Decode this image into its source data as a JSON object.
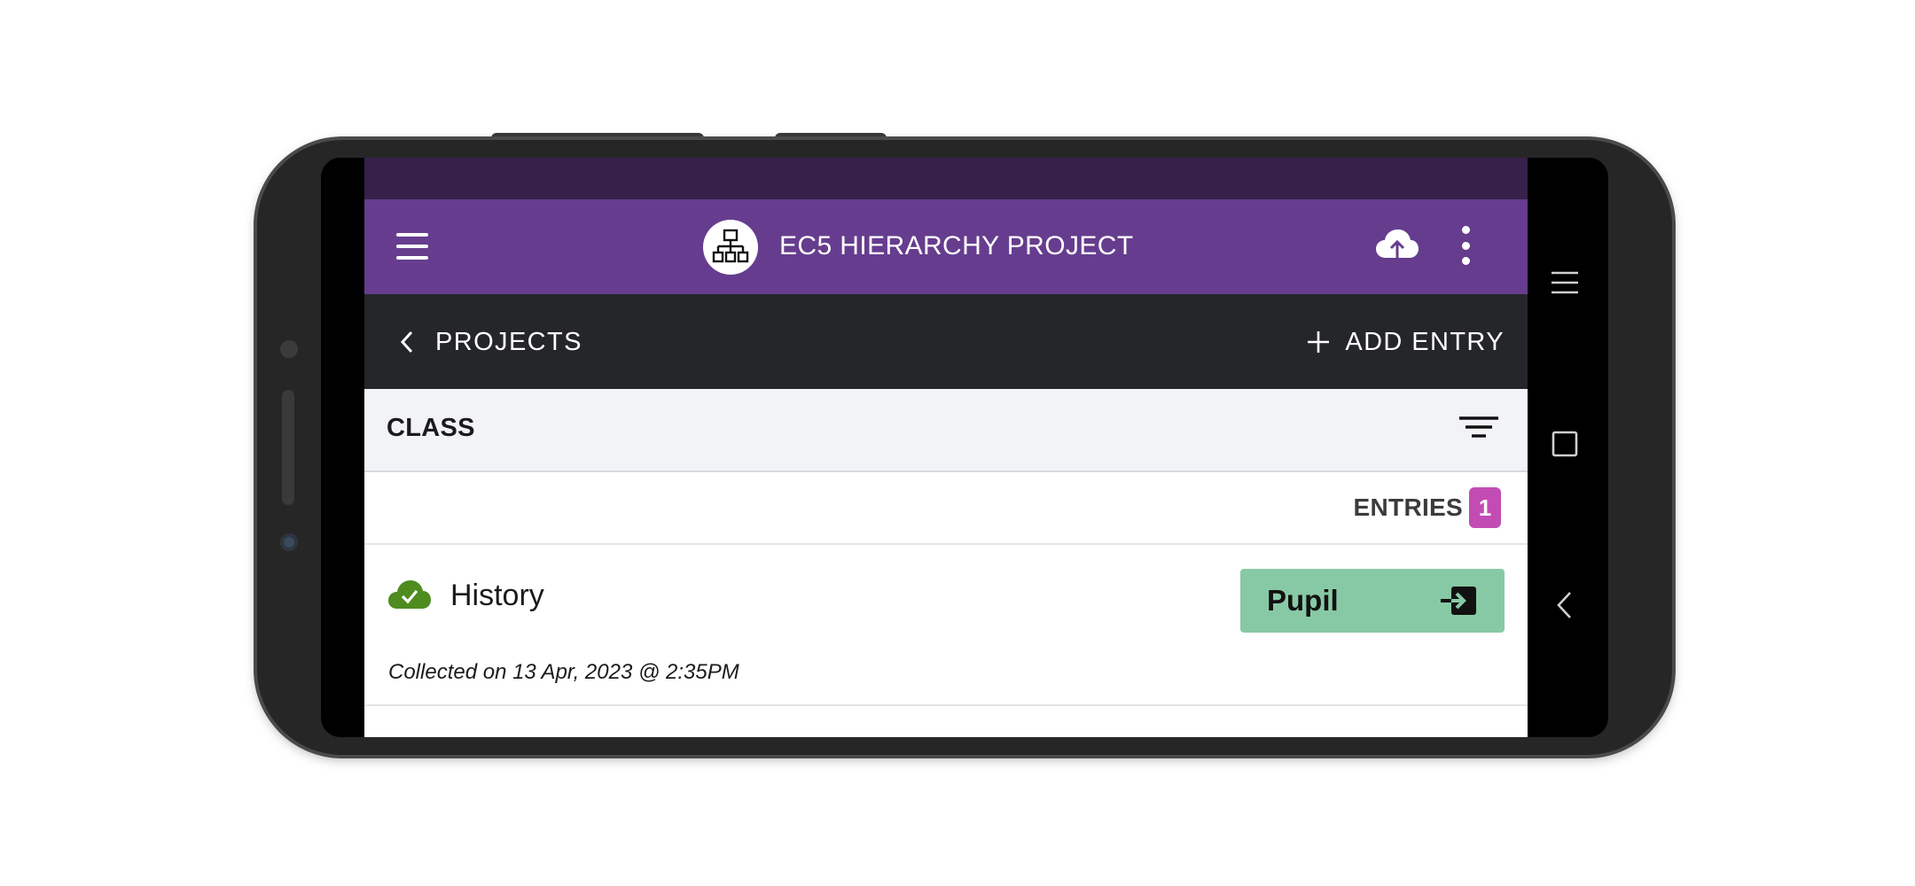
{
  "app_bar": {
    "title": "EC5 HIERARCHY PROJECT",
    "logo_icon": "hierarchy-icon",
    "upload_icon": "cloud-upload-icon",
    "menu_icon": "more-vert-icon",
    "background": "#663d8e"
  },
  "nav_bar": {
    "back_label": "PROJECTS",
    "add_label": "ADD ENTRY"
  },
  "form": {
    "name": "CLASS"
  },
  "entries": {
    "label": "ENTRIES",
    "count": "1",
    "badge_color": "#c24cb3"
  },
  "entry_list": [
    {
      "title": "History",
      "status_icon": "cloud-check-icon",
      "collected": "Collected on 13 Apr, 2023 @ 2:35PM",
      "child_button": "Pupil"
    }
  ],
  "system_nav": {
    "menu_icon": "menu-icon",
    "home_icon": "square-icon",
    "back_icon": "back-chevron-icon"
  }
}
